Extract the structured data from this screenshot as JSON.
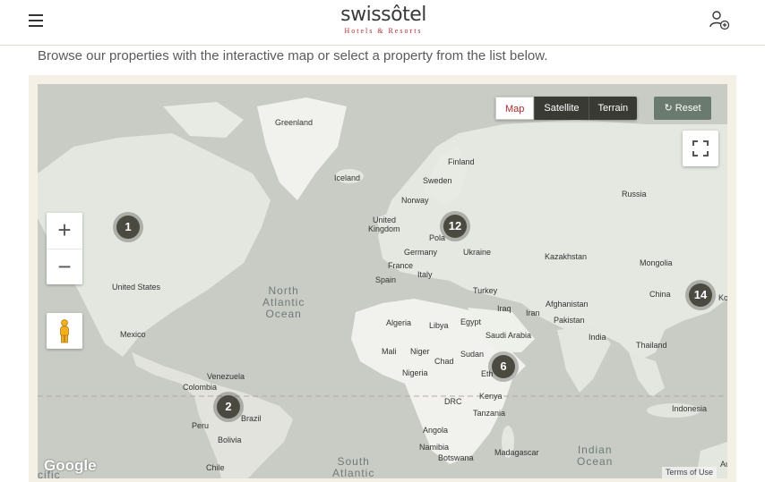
{
  "header": {
    "brand_main": "swissôtel",
    "brand_sub": "Hotels & Resorts",
    "menu_icon": "hamburger-menu-icon",
    "account_icon": "user-add-icon"
  },
  "intro_text": "Browse our properties with the interactive map or select a property from the list below.",
  "map_controls": {
    "map_types": [
      "Map",
      "Satellite",
      "Terrain"
    ],
    "selected_type": "Map",
    "reset_label": "Reset",
    "zoom_in": "+",
    "zoom_out": "−",
    "fullscreen_icon": "fullscreen-icon",
    "street_view_icon": "pegman-icon"
  },
  "countries": {
    "greenland": "Greenland",
    "finland": "Finland",
    "iceland": "Iceland",
    "sweden": "Sweden",
    "norway": "Norway",
    "russia": "Russia",
    "uk_line1": "United",
    "uk_line2": "Kingdom",
    "poland": "Pola",
    "germany": "Germany",
    "ukraine": "Ukraine",
    "france": "France",
    "kazakhstan": "Kazakhstan",
    "mongolia": "Mongolia",
    "spain": "Spain",
    "italy": "Italy",
    "turkey": "Turkey",
    "usa": "United States",
    "china": "China",
    "korea": "Ko",
    "afghanistan": "Afghanistan",
    "iraq": "Iraq",
    "iran": "Iran",
    "pakistan": "Pakistan",
    "algeria": "Algeria",
    "libya": "Libya",
    "egypt": "Egypt",
    "mexico": "Mexico",
    "saudi": "Saudi Arabia",
    "india": "India",
    "thailand": "Thailand",
    "mali": "Mali",
    "niger": "Niger",
    "sudan": "Sudan",
    "chad": "Chad",
    "nigeria": "Nigeria",
    "ethiopia": "Eth",
    "venezuela": "Venezuela",
    "colombia": "Colombia",
    "kenya": "Kenya",
    "drc": "DRC",
    "tanzania": "Tanzania",
    "indonesia": "Indonesia",
    "peru": "Peru",
    "brazil": "Brazil",
    "bolivia": "Bolivia",
    "angola": "Angola",
    "namibia": "Namibia",
    "botswana": "Botswana",
    "madagascar": "Madagascar",
    "chile": "Chile",
    "au": "Au"
  },
  "oceans": {
    "north_atlantic": [
      "North",
      "Atlantic",
      "Ocean"
    ],
    "south_atlantic": [
      "South",
      "Atlantic"
    ],
    "indian": [
      "Indian",
      "Ocean"
    ],
    "pacific": "cific"
  },
  "clusters": [
    {
      "id": "north-america",
      "count": "1"
    },
    {
      "id": "europe",
      "count": "12"
    },
    {
      "id": "asia",
      "count": "14"
    },
    {
      "id": "africa",
      "count": "6"
    },
    {
      "id": "south-america",
      "count": "2"
    }
  ],
  "attribution": {
    "google": "Google",
    "terms": "Terms of Use"
  },
  "colors": {
    "brand_red": "#b0282e",
    "water": "#c9ccc5",
    "land": "#e4e6e0",
    "cluster": "#4a4a40",
    "frame": "#f4f0e6"
  }
}
